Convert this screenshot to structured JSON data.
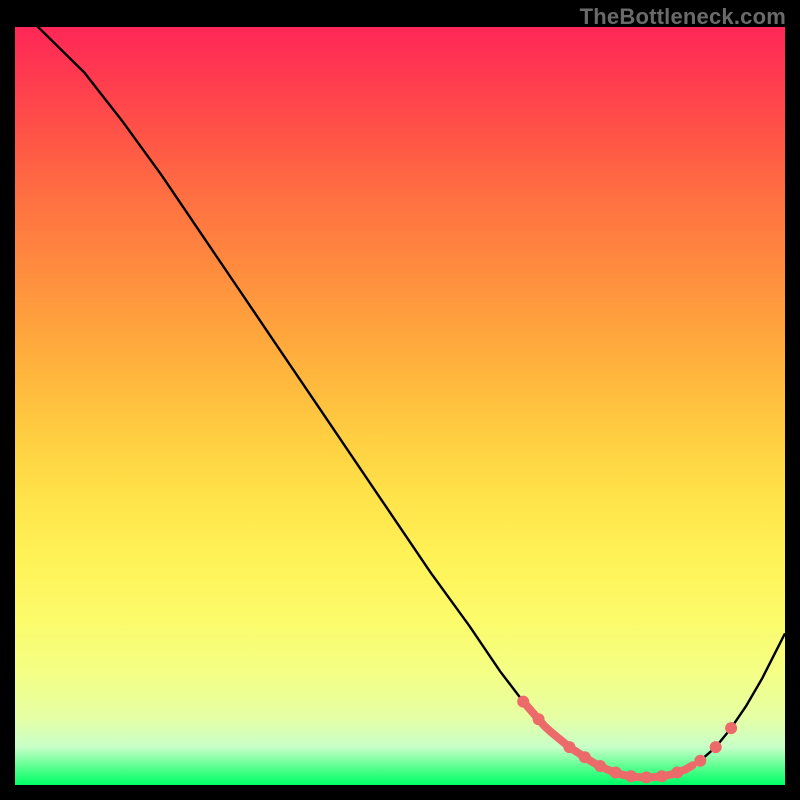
{
  "watermark": "TheBottleneck.com",
  "colors": {
    "curve": "#000000",
    "marker": "#ec6a6a",
    "gradient_top": "#ff2757",
    "gradient_bottom": "#00ff66"
  },
  "chart_data": {
    "type": "line",
    "title": "",
    "xlabel": "",
    "ylabel": "",
    "xlim": [
      0,
      100
    ],
    "ylim": [
      0,
      100
    ],
    "series": [
      {
        "name": "bottleneck-curve",
        "x": [
          0,
          4,
          9,
          14,
          19,
          24,
          29,
          34,
          39,
          44,
          49,
          54,
          59,
          63,
          66,
          69,
          72,
          75,
          77,
          79,
          81,
          83,
          85,
          87,
          89,
          91,
          93,
          95,
          97,
          99,
          100
        ],
        "y": [
          103,
          99,
          94,
          87.5,
          80.5,
          73,
          65.5,
          58,
          50.5,
          43,
          35.5,
          28,
          21,
          15,
          11,
          7.5,
          5,
          3,
          2,
          1.3,
          1,
          1,
          1.3,
          2,
          3.2,
          5,
          7.5,
          10.5,
          14,
          18,
          20
        ]
      }
    ],
    "highlight": {
      "band_x": [
        66,
        88
      ],
      "marker_x": [
        66,
        68,
        72,
        74,
        76,
        78,
        80,
        82,
        84,
        86,
        89,
        91,
        93
      ]
    }
  }
}
